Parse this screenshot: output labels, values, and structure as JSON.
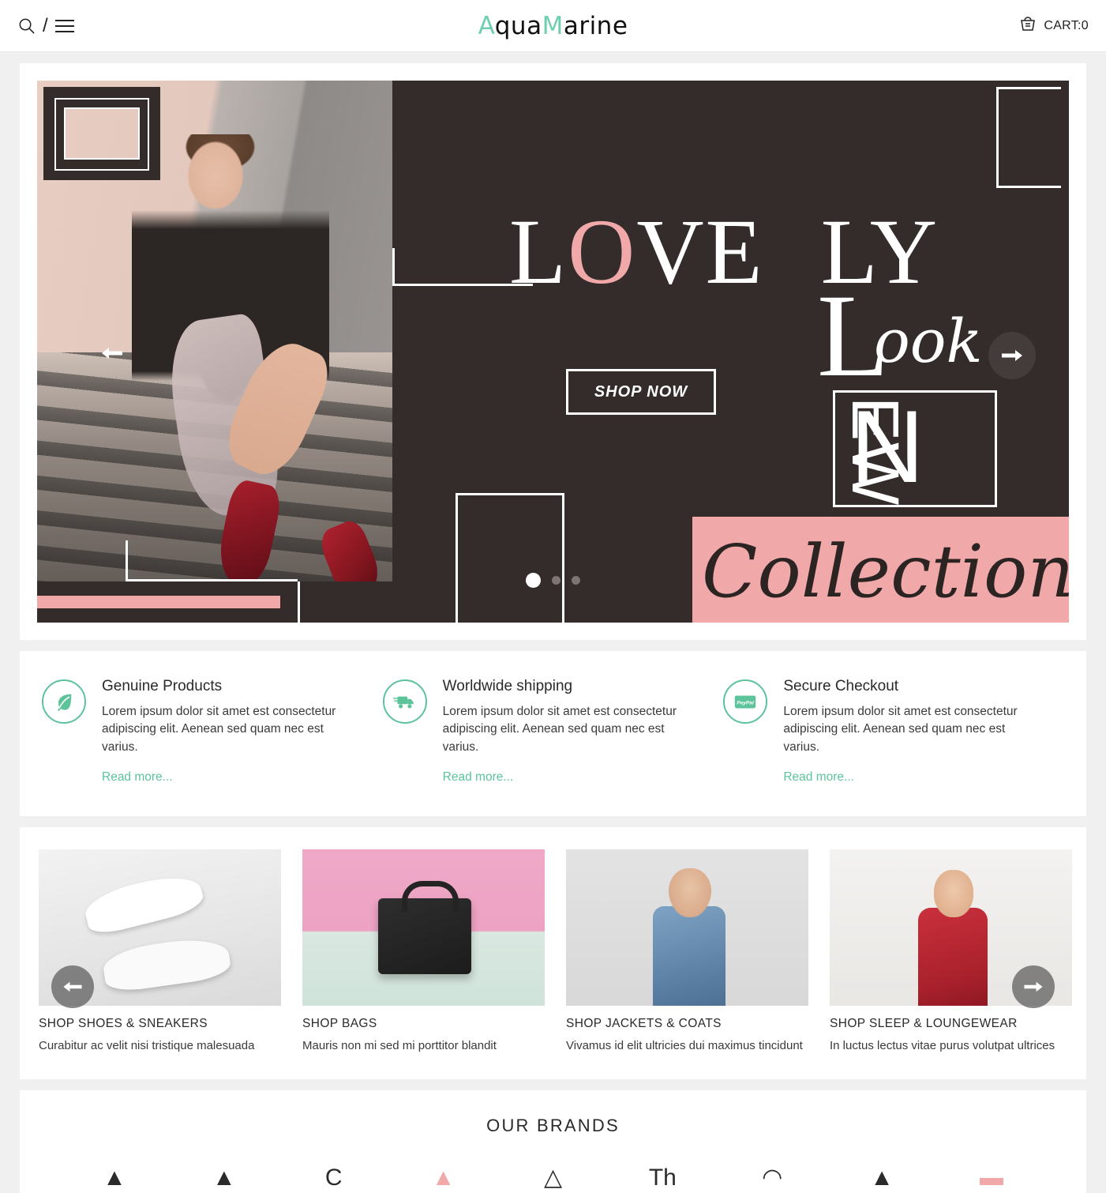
{
  "theme": {
    "mint": "#5cc39b",
    "pink": "#f0a8a8",
    "dark": "#332c2b",
    "page_bg": "#f0f0f0"
  },
  "header": {
    "search_icon": "search-icon",
    "separator": "/",
    "menu_icon": "hamburger-icon",
    "logo_part1": "Aqua",
    "logo_part2": "M",
    "logo_part3": "arine",
    "logo_aqua_A": "A",
    "logo_aqua_rest": "qua",
    "cart_icon": "basket-icon",
    "cart_label": "CART:0"
  },
  "hero": {
    "headline_l": "L",
    "headline_o": "O",
    "headline_ve": "VE",
    "headline_ly": "LY",
    "look_L": "L",
    "look_rest": "ook",
    "new_n": "N",
    "new_ew": "EW",
    "collection": "Collection",
    "shop_now": "SHOP NOW",
    "prev_arrow": "←",
    "next_arrow": "→",
    "dots": [
      {
        "active": true
      },
      {
        "active": false
      },
      {
        "active": false
      }
    ]
  },
  "features": [
    {
      "icon": "leaf-icon",
      "title": "Genuine Products",
      "desc": "Lorem ipsum dolor sit amet est consectetur adipiscing elit. Aenean sed quam nec est varius.",
      "link": "Read more..."
    },
    {
      "icon": "truck-icon",
      "title": "Worldwide shipping",
      "desc": "Lorem ipsum dolor sit amet est consectetur adipiscing elit. Aenean sed quam nec est varius.",
      "link": "Read more..."
    },
    {
      "icon": "paypal-card-icon",
      "title": "Secure Checkout",
      "desc": "Lorem ipsum dolor sit amet est consectetur adipiscing elit. Aenean sed quam nec est varius.",
      "link": "Read more..."
    }
  ],
  "categories": {
    "prev_arrow": "←",
    "next_arrow": "→",
    "items": [
      {
        "image": "white-sneakers-photo",
        "title": "SHOP SHOES & SNEAKERS",
        "desc": "Curabitur ac velit nisi tristique malesuada"
      },
      {
        "image": "black-handbag-photo",
        "title": "SHOP BAGS",
        "desc": "Mauris non mi sed mi porttitor blandit"
      },
      {
        "image": "denim-jacket-model-photo",
        "title": "SHOP JACKETS & COATS",
        "desc": "Vivamus id elit ultricies dui maximus tincidunt"
      },
      {
        "image": "red-polkadot-dress-model-photo",
        "title": "SHOP SLEEP & LOUNGEWEAR",
        "desc": "In luctus lectus vitae purus volutpat ultrices"
      }
    ]
  },
  "brands": {
    "title": "OUR BRANDS",
    "items": [
      {
        "mark": "▲",
        "name": ""
      },
      {
        "mark": "▲",
        "name": ""
      },
      {
        "mark": "C",
        "name": ""
      },
      {
        "mark": "▲",
        "name": ""
      },
      {
        "mark": "△",
        "name": ""
      },
      {
        "mark": "Th",
        "name": ""
      },
      {
        "mark": "◠",
        "name": ""
      },
      {
        "mark": "▲",
        "name": ""
      },
      {
        "mark": "▬",
        "name": ""
      }
    ]
  }
}
